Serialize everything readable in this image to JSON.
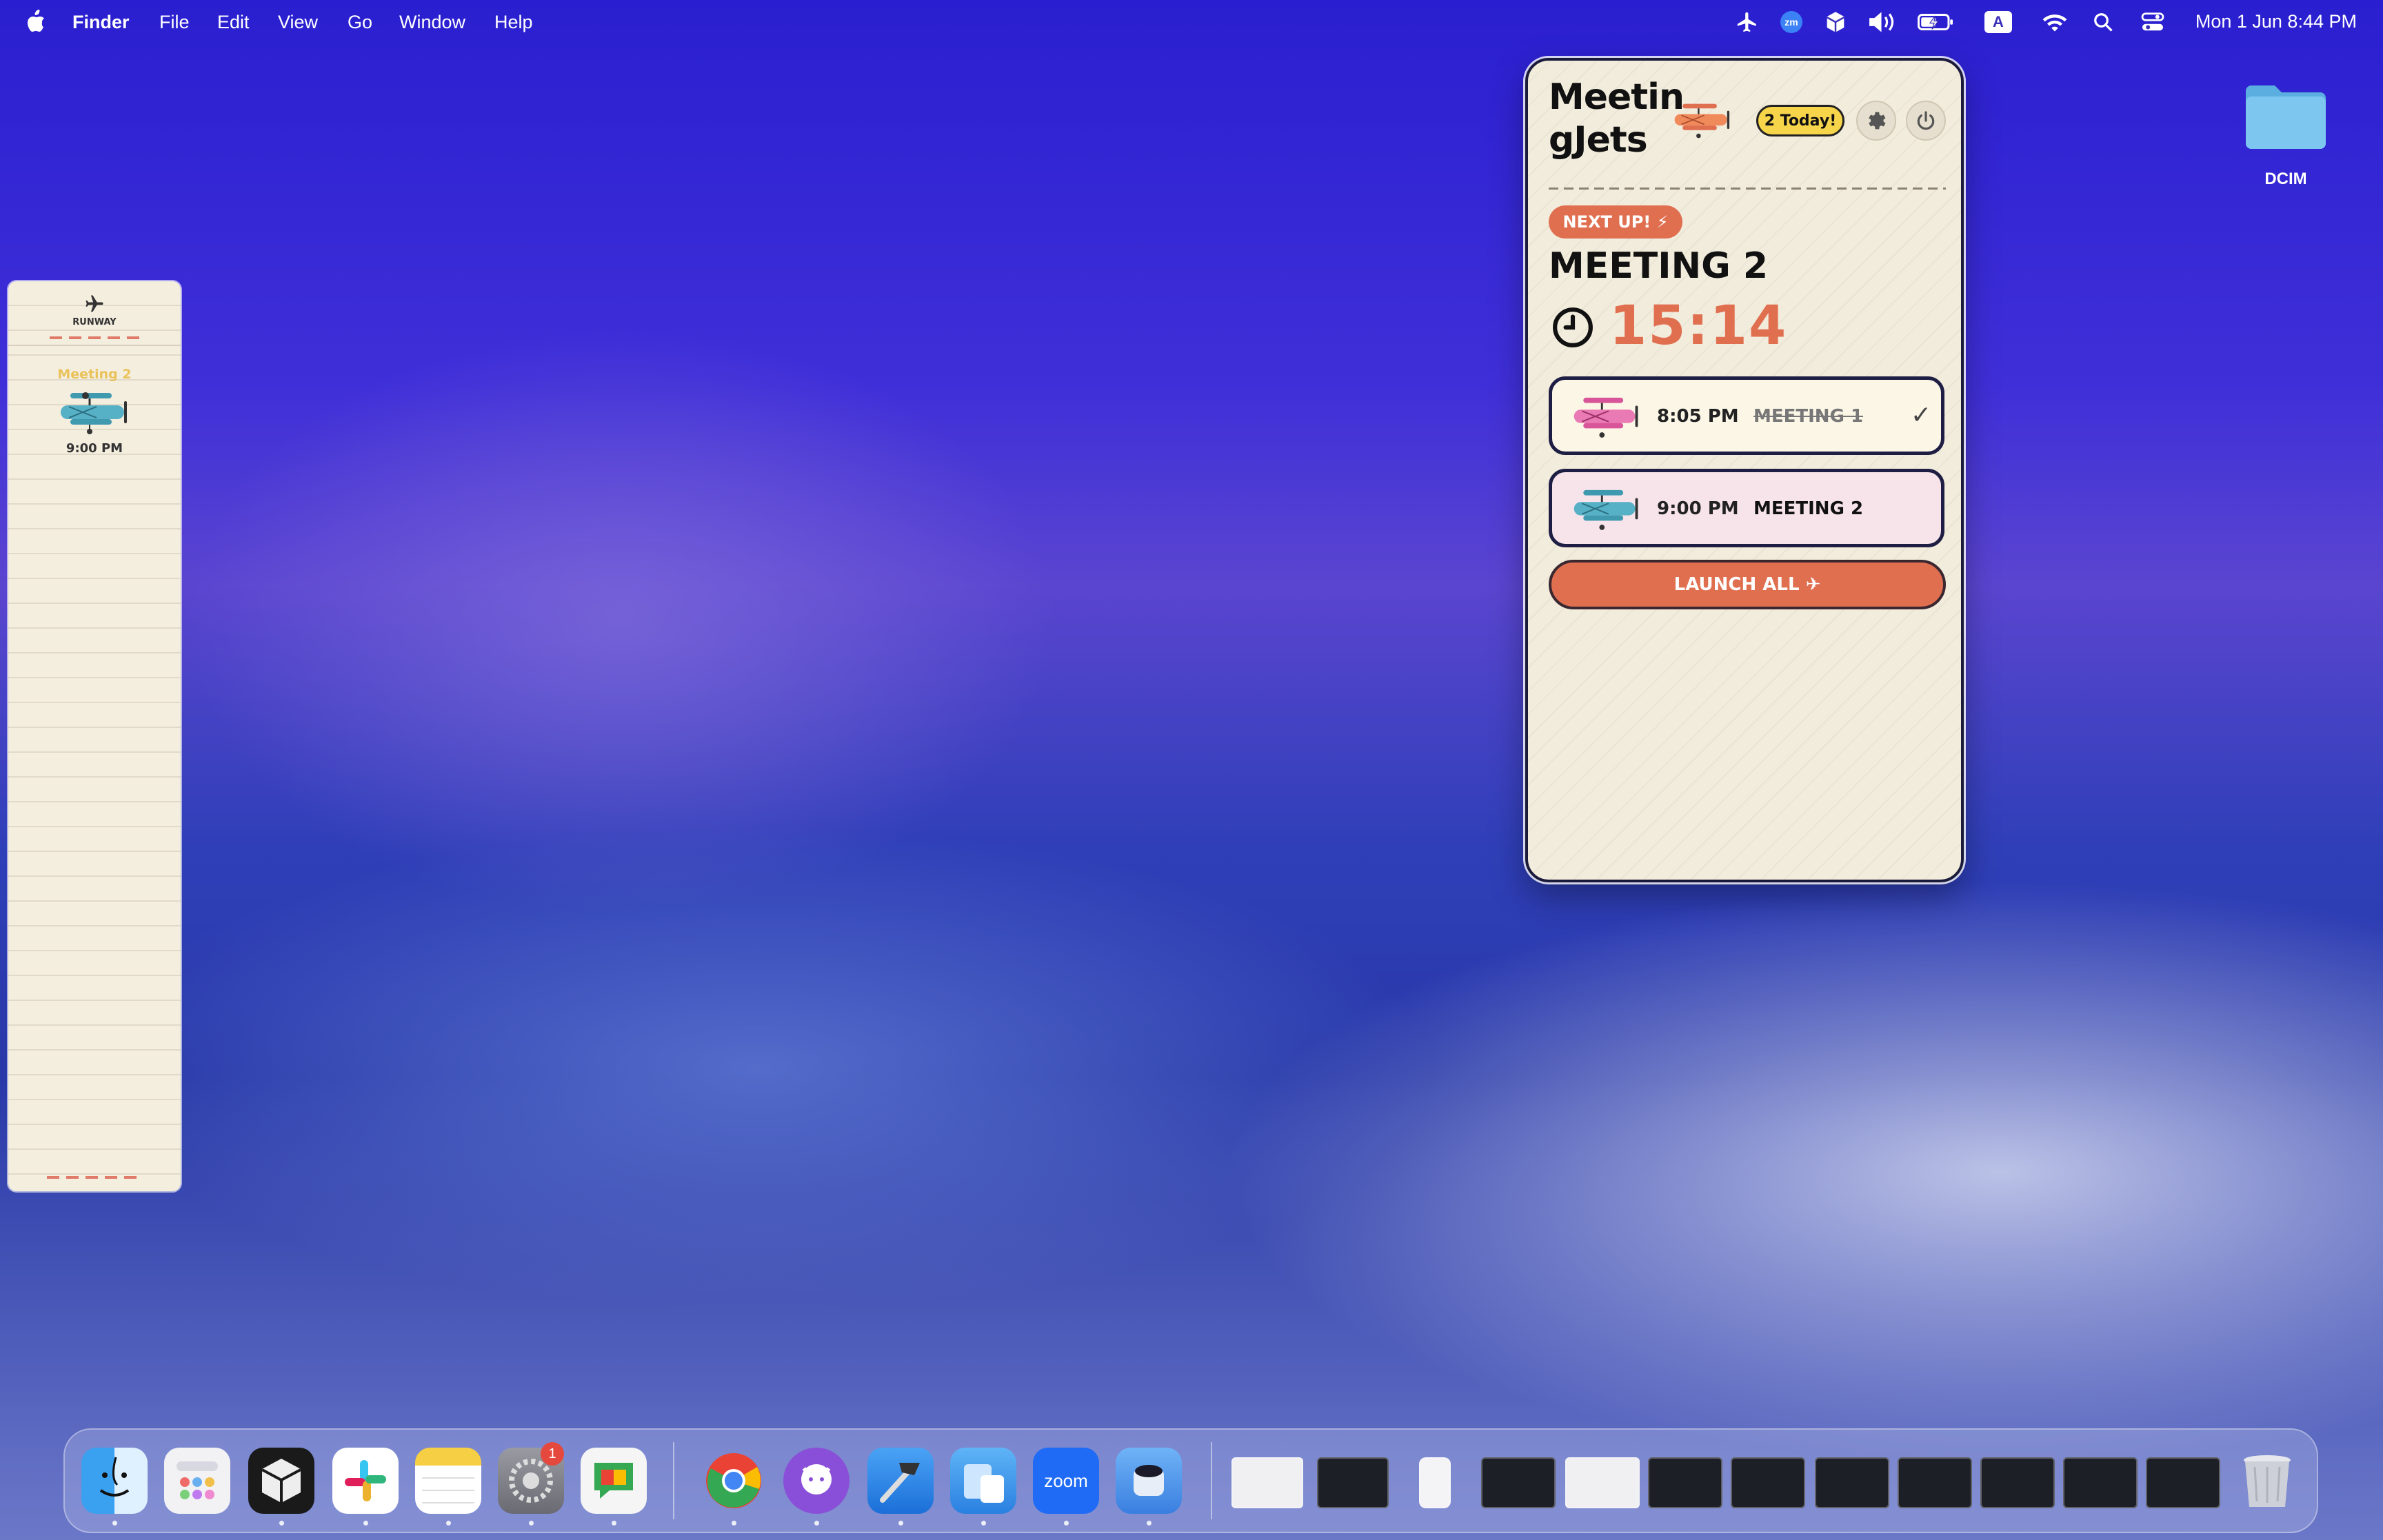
{
  "menubar": {
    "app_name": "Finder",
    "menus": [
      "File",
      "Edit",
      "View",
      "Go",
      "Window",
      "Help"
    ],
    "status_icons": [
      "airplane-icon",
      "zoom-icon",
      "box-icon",
      "volume-icon",
      "battery-icon",
      "input-source-icon",
      "wifi-icon",
      "search-icon",
      "control-center-icon"
    ],
    "zoom_glyph": "zm",
    "input_source": "A",
    "clock": "Mon 1 Jun  8:44 PM"
  },
  "desktop": {
    "folder_label": "DCIM"
  },
  "runway": {
    "label": "RUNWAY",
    "meeting_name": "Meeting 2",
    "meeting_time": "9:00 PM"
  },
  "panel": {
    "title": "Meetin gJets",
    "today_badge": "2 Today!",
    "next_up_label": "NEXT UP! ⚡",
    "next_meeting": "MEETING 2",
    "countdown": "15:14",
    "meetings": [
      {
        "time": "8:05 PM",
        "name": "MEETING 1",
        "done": true,
        "check": "✓",
        "plane_color": "#d9559a"
      },
      {
        "time": "9:00 PM",
        "name": "MEETING 2",
        "done": false,
        "check": "",
        "plane_color": "#3f9ab0"
      }
    ],
    "launch_label": "LAUNCH ALL ✈"
  },
  "dock": {
    "apps": [
      "Finder",
      "Launchpad",
      "Box",
      "Slack",
      "Notes",
      "System Settings",
      "Google Chat",
      "Chrome",
      "GitHub Desktop",
      "Xcode",
      "Simulator",
      "Zoom",
      "Meetin gJets"
    ],
    "zoom_label": "zoom",
    "settings_badge": "1",
    "window_thumbnail_count": 12,
    "trash": "Trash"
  },
  "colors": {
    "accent_orange": "#e06f50",
    "badge_yellow": "#f7d54a",
    "panel_bg": "#f2ecdc",
    "card_done_bg": "#fbf6e6",
    "card_next_bg": "#f7e4ea"
  }
}
